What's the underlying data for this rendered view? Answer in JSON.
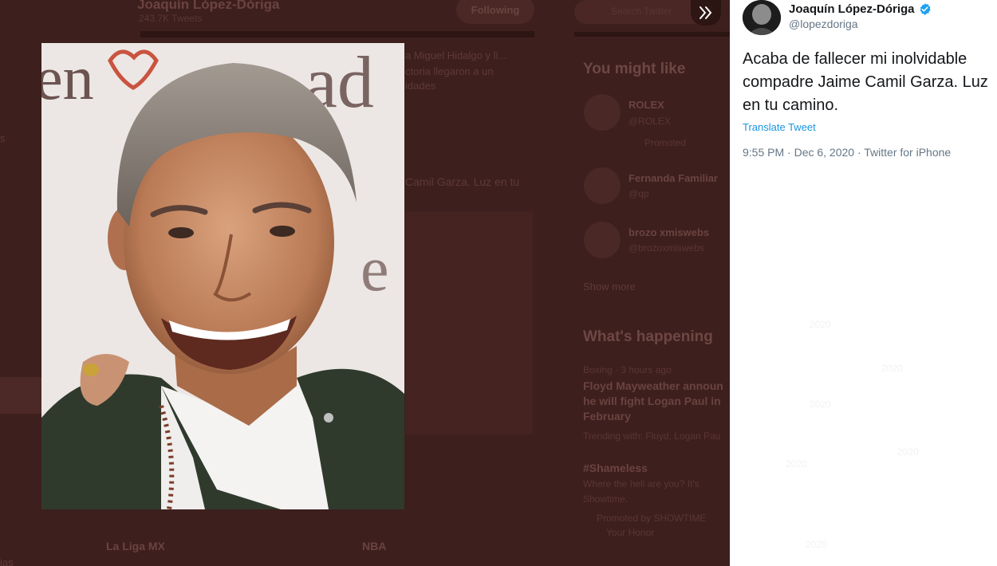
{
  "background": {
    "profile_name": "Joaquín López-Dóriga",
    "profile_tweets": "243.7K Tweets",
    "following_button": "Following",
    "search_placeholder": "Search Twitter",
    "snippet_line1": "a Miguel Hidalgo y li...",
    "snippet_line2": "ctoria llegaron a un",
    "snippet_line3": "idades",
    "snippet_line4": "Camil Garza. Luz en tu",
    "left_edge_s": "s",
    "left_edge_ias": "ias",
    "might_like_title": "You might like",
    "suggestions": [
      {
        "name": "ROLEX",
        "handle": "@ROLEX",
        "extra": "Promoted"
      },
      {
        "name": "Fernanda Familiar",
        "handle": "@qp"
      },
      {
        "name": "brozo xmiswebs",
        "handle": "@brozoxmiswebs"
      }
    ],
    "show_more": "Show more",
    "happening_title": "What's happening",
    "trend_meta": "Boxing · 3 hours ago",
    "trend_headline_1": "Floyd Mayweather announ",
    "trend_headline_2": "he will fight Logan Paul in",
    "trend_headline_3": "February",
    "trend_with": "Trending with: Floyd, Logan Pau",
    "hashtag": "#Shameless",
    "hashtag_sub_1": "Where the hell are you? It's",
    "hashtag_sub_2": "Showtime.",
    "promoted_by": "Promoted by SHOWTIME",
    "promoted_sub": "Your Honor",
    "tab_la_liga": "La Liga MX",
    "tab_nba": "NBA"
  },
  "tweet": {
    "author_name": "Joaquín López-Dóriga",
    "handle": "@lopezdoriga",
    "text": "Acaba de fallecer mi inolvidable compadre Jaime Camil Garza. Luz en tu camino.",
    "translate_label": "Translate Tweet",
    "timestamp": "9:55 PM · Dec 6, 2020 · Twitter for iPhone"
  },
  "icons": {
    "expand": "double-chevron-right-icon",
    "verified": "verified-badge-icon"
  },
  "colors": {
    "overlay_bg": "#3d1f1d",
    "link_blue": "#1b95e0",
    "verified_blue": "#1da1f2",
    "text_dark": "#14171a",
    "text_gray": "#657786"
  }
}
